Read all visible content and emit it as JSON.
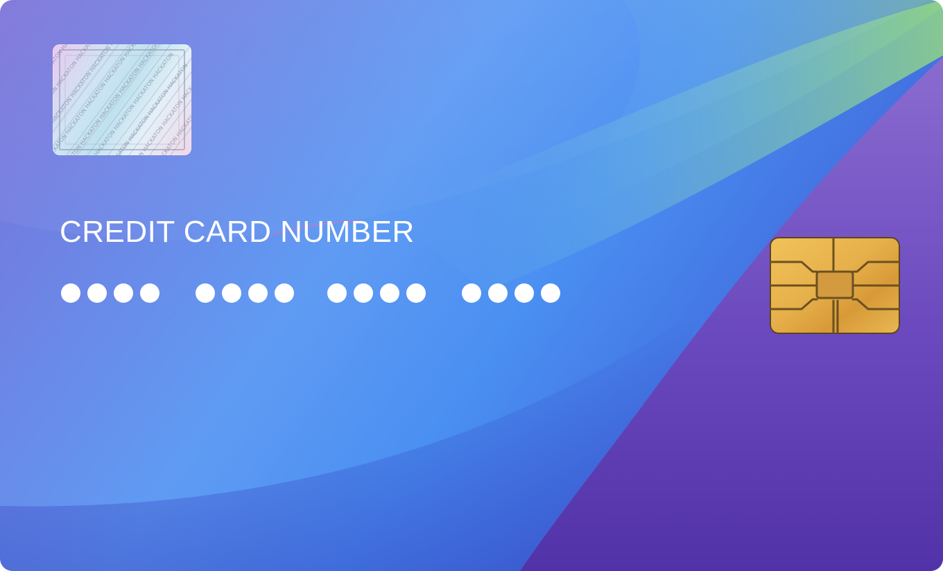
{
  "card": {
    "label": "CREDIT CARD NUMBER",
    "number_groups": [
      {
        "dots": [
          1,
          2,
          3,
          4
        ]
      },
      {
        "dots": [
          1,
          2,
          3,
          4
        ]
      },
      {
        "dots": [
          1,
          2,
          3,
          4
        ]
      },
      {
        "dots": [
          1,
          2,
          3,
          4
        ]
      }
    ],
    "hologram_text": "HACKATON",
    "icons": {
      "hologram": "hologram-sticker",
      "chip": "emv-chip-icon"
    },
    "colors": {
      "gradient_start": "#7a70d8",
      "gradient_mid": "#4a8ff2",
      "gradient_end": "#3b3fc2",
      "purple_band": "#6a48bd",
      "green_highlight": "#8fd48a",
      "chip_gold": "#e0ab45",
      "text": "#ffffff"
    }
  }
}
